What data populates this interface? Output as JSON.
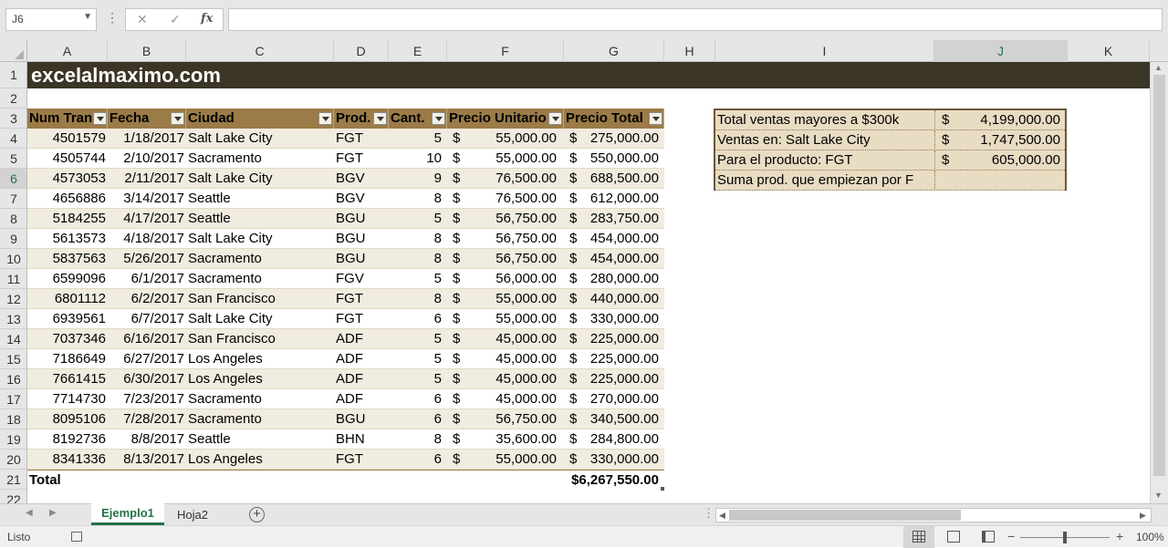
{
  "formula_bar": {
    "name_box": "J6",
    "cancel_icon": "✕",
    "enter_icon": "✓",
    "fx_label": "fx",
    "formula": ""
  },
  "columns": [
    "A",
    "B",
    "C",
    "D",
    "E",
    "F",
    "G",
    "H",
    "I",
    "J",
    "K"
  ],
  "rows": [
    "1",
    "2",
    "3",
    "4",
    "5",
    "6",
    "7",
    "8",
    "9",
    "10",
    "11",
    "12",
    "13",
    "14",
    "15",
    "16",
    "17",
    "18",
    "19",
    "20",
    "21",
    "22"
  ],
  "banner": "excelalmaximo.com",
  "table": {
    "headers": [
      "Num Tran",
      "Fecha",
      "Ciudad",
      "Prod.",
      "Cant.",
      "Precio Unitario",
      "Precio Total"
    ],
    "rows": [
      [
        "4501579",
        "1/18/2017",
        "Salt Lake City",
        "FGT",
        "5",
        "$",
        "55,000.00",
        "$",
        "275,000.00"
      ],
      [
        "4505744",
        "2/10/2017",
        "Sacramento",
        "FGT",
        "10",
        "$",
        "55,000.00",
        "$",
        "550,000.00"
      ],
      [
        "4573053",
        "2/11/2017",
        "Salt Lake City",
        "BGV",
        "9",
        "$",
        "76,500.00",
        "$",
        "688,500.00"
      ],
      [
        "4656886",
        "3/14/2017",
        "Seattle",
        "BGV",
        "8",
        "$",
        "76,500.00",
        "$",
        "612,000.00"
      ],
      [
        "5184255",
        "4/17/2017",
        "Seattle",
        "BGU",
        "5",
        "$",
        "56,750.00",
        "$",
        "283,750.00"
      ],
      [
        "5613573",
        "4/18/2017",
        "Salt Lake City",
        "BGU",
        "8",
        "$",
        "56,750.00",
        "$",
        "454,000.00"
      ],
      [
        "5837563",
        "5/26/2017",
        "Sacramento",
        "BGU",
        "8",
        "$",
        "56,750.00",
        "$",
        "454,000.00"
      ],
      [
        "6599096",
        "6/1/2017",
        "Sacramento",
        "FGV",
        "5",
        "$",
        "56,000.00",
        "$",
        "280,000.00"
      ],
      [
        "6801112",
        "6/2/2017",
        "San Francisco",
        "FGT",
        "8",
        "$",
        "55,000.00",
        "$",
        "440,000.00"
      ],
      [
        "6939561",
        "6/7/2017",
        "Salt Lake City",
        "FGT",
        "6",
        "$",
        "55,000.00",
        "$",
        "330,000.00"
      ],
      [
        "7037346",
        "6/16/2017",
        "San Francisco",
        "ADF",
        "5",
        "$",
        "45,000.00",
        "$",
        "225,000.00"
      ],
      [
        "7186649",
        "6/27/2017",
        "Los Angeles",
        "ADF",
        "5",
        "$",
        "45,000.00",
        "$",
        "225,000.00"
      ],
      [
        "7661415",
        "6/30/2017",
        "Los Angeles",
        "ADF",
        "5",
        "$",
        "45,000.00",
        "$",
        "225,000.00"
      ],
      [
        "7714730",
        "7/23/2017",
        "Sacramento",
        "ADF",
        "6",
        "$",
        "45,000.00",
        "$",
        "270,000.00"
      ],
      [
        "8095106",
        "7/28/2017",
        "Sacramento",
        "BGU",
        "6",
        "$",
        "56,750.00",
        "$",
        "340,500.00"
      ],
      [
        "8192736",
        "8/8/2017",
        "Seattle",
        "BHN",
        "8",
        "$",
        "35,600.00",
        "$",
        "284,800.00"
      ],
      [
        "8341336",
        "8/13/2017",
        "Los Angeles",
        "FGT",
        "6",
        "$",
        "55,000.00",
        "$",
        "330,000.00"
      ]
    ],
    "total_label": "Total",
    "total_value": "$6,267,550.00"
  },
  "summary": [
    {
      "label": "Total ventas mayores a $300k",
      "currency": "$",
      "value": "4,199,000.00"
    },
    {
      "label": "Ventas en: Salt Lake City",
      "currency": "$",
      "value": "1,747,500.00"
    },
    {
      "label": "Para el producto:  FGT",
      "currency": "$",
      "value": "605,000.00"
    },
    {
      "label": "Suma prod. que empiezan por F",
      "currency": "",
      "value": ""
    }
  ],
  "sheets": [
    "Ejemplo1",
    "Hoja2"
  ],
  "add_sheet_icon": "+",
  "status": {
    "ready": "Listo",
    "zoom": "100%",
    "zoom_minus": "−",
    "zoom_plus": "+"
  }
}
